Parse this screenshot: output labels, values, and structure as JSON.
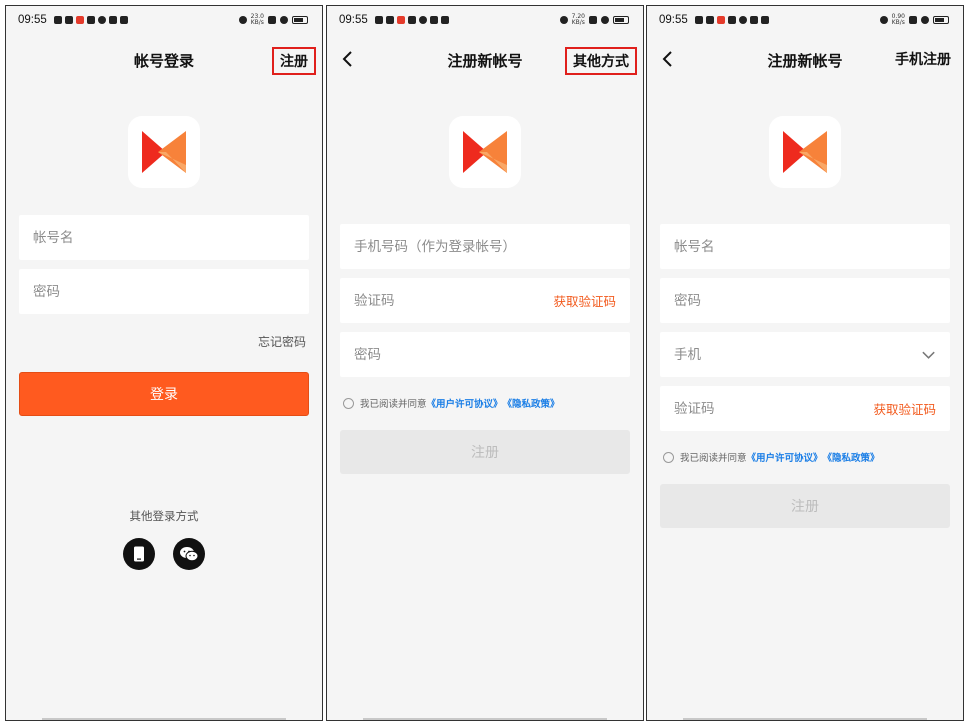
{
  "status": {
    "time": "09:55",
    "speed1": "23.0\nKB/s",
    "speed2": "7.20\nKB/s",
    "speed3": "0.90\nKB/s"
  },
  "screen1": {
    "title": "帐号登录",
    "nav_right": "注册",
    "username_placeholder": "帐号名",
    "password_placeholder": "密码",
    "forgot": "忘记密码",
    "login_button": "登录",
    "other_login": "其他登录方式"
  },
  "screen2": {
    "title": "注册新帐号",
    "nav_right": "其他方式",
    "phone_placeholder": "手机号码（作为登录帐号）",
    "code_placeholder": "验证码",
    "get_code": "获取验证码",
    "password_placeholder": "密码",
    "agree_prefix": "我已阅读并同意",
    "user_agreement": "《用户许可协议》",
    "privacy_policy": "《隐私政策》",
    "register_button": "注册"
  },
  "screen3": {
    "title": "注册新帐号",
    "nav_right": "手机注册",
    "username_placeholder": "帐号名",
    "password_placeholder": "密码",
    "phone_placeholder": "手机",
    "code_placeholder": "验证码",
    "get_code": "获取验证码",
    "agree_prefix": "我已阅读并同意",
    "user_agreement": "《用户许可协议》",
    "privacy_policy": "《隐私政策》",
    "register_button": "注册"
  },
  "colors": {
    "accent": "#ff5a1f",
    "link": "#1a7ee6",
    "highlight_box": "#e0201c"
  }
}
